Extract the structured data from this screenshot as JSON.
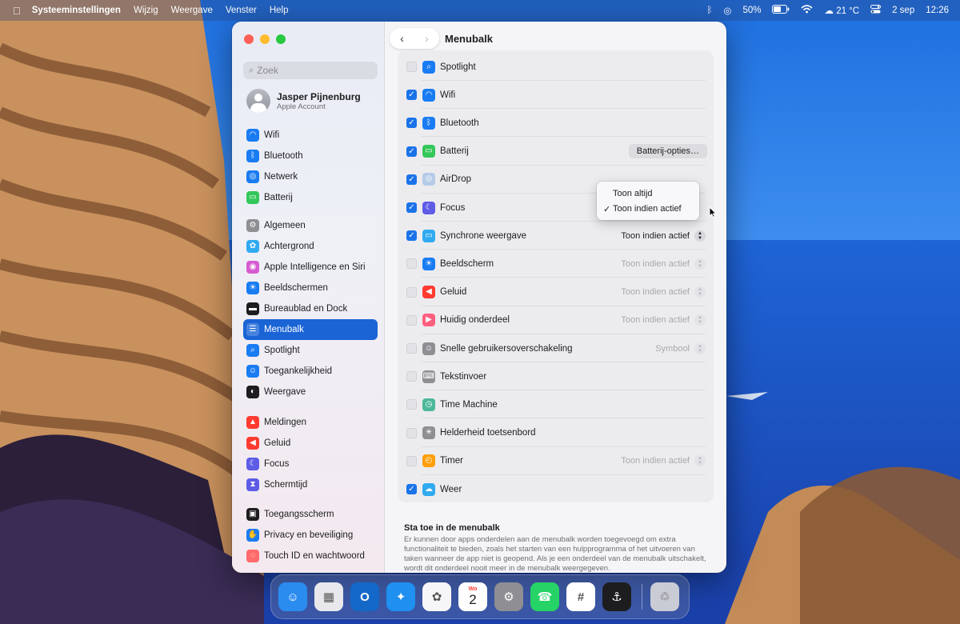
{
  "menubar": {
    "app_name": "Systeeminstellingen",
    "menus": [
      "Wijzig",
      "Weergave",
      "Venster",
      "Help"
    ],
    "battery": "50%",
    "weather": "21 °C",
    "date": "2 sep",
    "time": "12:26"
  },
  "window": {
    "title": "Menubalk",
    "search_placeholder": "Zoek",
    "account": {
      "name": "Jasper Pijnenburg",
      "subtitle": "Apple Account"
    },
    "sidebar_groups": [
      [
        {
          "label": "Wifi",
          "icon": "wifi-icon",
          "color": "#1a7cf2"
        },
        {
          "label": "Bluetooth",
          "icon": "bluetooth-icon",
          "color": "#1a7cf2"
        },
        {
          "label": "Netwerk",
          "icon": "globe-icon",
          "color": "#1a7cf2"
        },
        {
          "label": "Batterij",
          "icon": "battery-icon",
          "color": "#34c759"
        }
      ],
      [
        {
          "label": "Algemeen",
          "icon": "gear-icon",
          "color": "#8e8e93"
        },
        {
          "label": "Achtergrond",
          "icon": "flower-icon",
          "color": "#30aaf0"
        },
        {
          "label": "Apple Intelligence en Siri",
          "icon": "siri-icon",
          "color": "#d65bd1"
        },
        {
          "label": "Beeldschermen",
          "icon": "sun-icon",
          "color": "#1a7cf2"
        },
        {
          "label": "Bureaublad en Dock",
          "icon": "dock-icon",
          "color": "#1d1d1f"
        },
        {
          "label": "Menubalk",
          "icon": "menubar-icon",
          "color": "#1d1d1f",
          "selected": true
        },
        {
          "label": "Spotlight",
          "icon": "spotlight-icon",
          "color": "#1a7cf2"
        },
        {
          "label": "Toegankelijkheid",
          "icon": "accessibility-icon",
          "color": "#1a7cf2"
        },
        {
          "label": "Weergave",
          "icon": "appearance-icon",
          "color": "#1d1d1f"
        }
      ],
      [
        {
          "label": "Meldingen",
          "icon": "bell-icon",
          "color": "#ff3b30"
        },
        {
          "label": "Geluid",
          "icon": "speaker-icon",
          "color": "#ff3b30"
        },
        {
          "label": "Focus",
          "icon": "moon-icon",
          "color": "#5e5ce6"
        },
        {
          "label": "Schermtijd",
          "icon": "hourglass-icon",
          "color": "#5e5ce6"
        }
      ],
      [
        {
          "label": "Toegangsscherm",
          "icon": "lock-icon",
          "color": "#1d1d1f"
        },
        {
          "label": "Privacy en beveiliging",
          "icon": "hand-icon",
          "color": "#1a7cf2"
        },
        {
          "label": "Touch ID en wachtwoord",
          "icon": "fingerprint-icon",
          "color": "#ff6b6b"
        }
      ]
    ],
    "items": [
      {
        "label": "Spotlight",
        "checked": false,
        "icon": "spotlight-icon",
        "color": "#1a7cf2"
      },
      {
        "label": "Wifi",
        "checked": true,
        "icon": "wifi-icon",
        "color": "#1a7cf2"
      },
      {
        "label": "Bluetooth",
        "checked": true,
        "icon": "bluetooth-icon",
        "color": "#1a7cf2"
      },
      {
        "label": "Batterij",
        "checked": true,
        "icon": "battery-icon",
        "color": "#34c759",
        "button": "Batterij-opties…"
      },
      {
        "label": "AirDrop",
        "checked": true,
        "icon": "airdrop-icon",
        "color": "#b5cbe8"
      },
      {
        "label": "Focus",
        "checked": true,
        "icon": "moon-icon",
        "color": "#5e5ce6"
      },
      {
        "label": "Synchrone weergave",
        "checked": true,
        "icon": "screen-mirroring-icon",
        "color": "#30aaf0",
        "popup": "Toon indien actief",
        "popup_enabled": true
      },
      {
        "label": "Beeldscherm",
        "checked": false,
        "icon": "sun-icon",
        "color": "#1a7cf2",
        "popup": "Toon indien actief",
        "popup_enabled": false
      },
      {
        "label": "Geluid",
        "checked": false,
        "icon": "speaker-icon",
        "color": "#ff3b30",
        "popup": "Toon indien actief",
        "popup_enabled": false
      },
      {
        "label": "Huidig onderdeel",
        "checked": false,
        "icon": "now-playing-icon",
        "color": "#ff5f7e",
        "popup": "Toon indien actief",
        "popup_enabled": false
      },
      {
        "label": "Snelle gebruikersoverschakeling",
        "checked": false,
        "icon": "user-switch-icon",
        "color": "#8e8e93",
        "popup": "Symbool",
        "popup_enabled": false
      },
      {
        "label": "Tekstinvoer",
        "checked": false,
        "icon": "keyboard-icon",
        "color": "#8e8e93"
      },
      {
        "label": "Time Machine",
        "checked": false,
        "icon": "time-machine-icon",
        "color": "#4cb89a"
      },
      {
        "label": "Helderheid toetsenbord",
        "checked": false,
        "icon": "keyboard-brightness-icon",
        "color": "#8e8e93"
      },
      {
        "label": "Timer",
        "checked": false,
        "icon": "timer-icon",
        "color": "#ff9f0a",
        "popup": "Toon indien actief",
        "popup_enabled": false
      },
      {
        "label": "Weer",
        "checked": true,
        "icon": "weather-icon",
        "color": "#30aaf0"
      }
    ],
    "dropdown": {
      "options": [
        "Toon altijd",
        "Toon indien actief"
      ],
      "selected_index": 1
    },
    "allow_section": {
      "heading": "Sta toe in de menubalk",
      "text": "Er kunnen door apps onderdelen aan de menubalk worden toegevoegd om extra functionaliteit te bieden, zoals het starten van een hulpprogramma of het uitvoeren van taken wanneer de app niet is geopend. Als je een onderdeel van de menubalk uitschakelt, wordt dit onderdeel nooit meer in de menubalk weergegeven."
    }
  },
  "dock": {
    "calendar_month": "Wo",
    "calendar_day": "2",
    "apps": [
      {
        "icon": "finder-icon",
        "color": "#2b8cf0"
      },
      {
        "icon": "launchpad-icon",
        "color": "#e8e8ec"
      },
      {
        "icon": "outlook-icon",
        "color": "#1468c8"
      },
      {
        "icon": "safari-icon",
        "color": "#1f8ff0"
      },
      {
        "icon": "photos-icon",
        "color": "#f6f6f8"
      },
      {
        "icon": "calendar-icon",
        "color": "#ffffff"
      },
      {
        "icon": "system-settings-icon",
        "color": "#8e8e93"
      },
      {
        "icon": "whatsapp-icon",
        "color": "#25d366"
      },
      {
        "icon": "slack-icon",
        "color": "#ffffff"
      },
      {
        "icon": "keys-icon",
        "color": "#1d1d1f"
      },
      {
        "icon": "trash-icon",
        "color": "#c9ccd4"
      }
    ]
  }
}
